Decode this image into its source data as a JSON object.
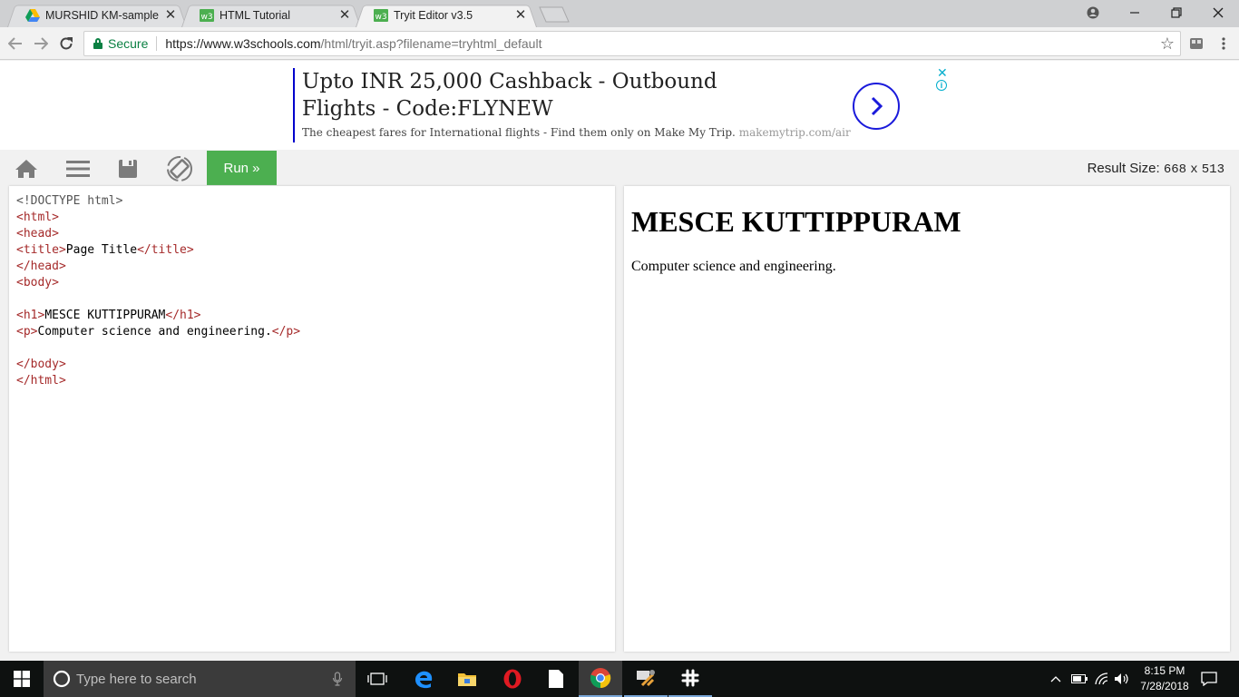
{
  "browser": {
    "tabs": [
      {
        "title": "MURSHID KM-sample pr",
        "favicon": "google-drive-icon"
      },
      {
        "title": "HTML Tutorial",
        "favicon": "w3schools-icon"
      },
      {
        "title": "Tryit Editor v3.5",
        "favicon": "w3schools-icon",
        "active": true
      }
    ],
    "close_glyph": "✕",
    "address": {
      "secure_label": "Secure",
      "url_host": "https://www.w3schools.com",
      "url_rest": "/html/tryit.asp?filename=tryhtml_default"
    }
  },
  "ad": {
    "headline": "Upto INR 25,000 Cashback - Outbound Flights - Code:FLYNEW",
    "description": "The cheapest fares for International flights - Find them only on Make My Trip.",
    "domain": "makemytrip.com/air",
    "close": "✕",
    "info": "i"
  },
  "tryit": {
    "run_label": "Run »",
    "result_size_label": "Result Size:",
    "result_width": "668",
    "result_times": "x",
    "result_height": "513",
    "code_lines": [
      [
        {
          "t": "doctype",
          "v": "<!DOCTYPE html>"
        }
      ],
      [
        {
          "t": "tag",
          "v": "<html>"
        }
      ],
      [
        {
          "t": "tag",
          "v": "<head>"
        }
      ],
      [
        {
          "t": "tag",
          "v": "<title>"
        },
        {
          "t": "txt",
          "v": "Page Title"
        },
        {
          "t": "tag",
          "v": "</title>"
        }
      ],
      [
        {
          "t": "tag",
          "v": "</head>"
        }
      ],
      [
        {
          "t": "tag",
          "v": "<body>"
        }
      ],
      [],
      [
        {
          "t": "tag",
          "v": "<h1>"
        },
        {
          "t": "txt",
          "v": "MESCE KUTTIPPURAM"
        },
        {
          "t": "tag",
          "v": "</h1>"
        }
      ],
      [
        {
          "t": "tag",
          "v": "<p>"
        },
        {
          "t": "txt",
          "v": "Computer science and engineering."
        },
        {
          "t": "tag",
          "v": "</p>"
        }
      ],
      [],
      [
        {
          "t": "tag",
          "v": "</body>"
        }
      ],
      [
        {
          "t": "tag",
          "v": "</html>"
        }
      ]
    ],
    "result": {
      "heading": "MESCE KUTTIPPURAM",
      "paragraph": "Computer science and engineering."
    }
  },
  "taskbar": {
    "search_placeholder": "Type here to search",
    "time": "8:15 PM",
    "date": "7/28/2018"
  },
  "colors": {
    "run_green": "#4caf50",
    "secure_green": "#0b8043",
    "code_tag": "#a52a2a"
  }
}
